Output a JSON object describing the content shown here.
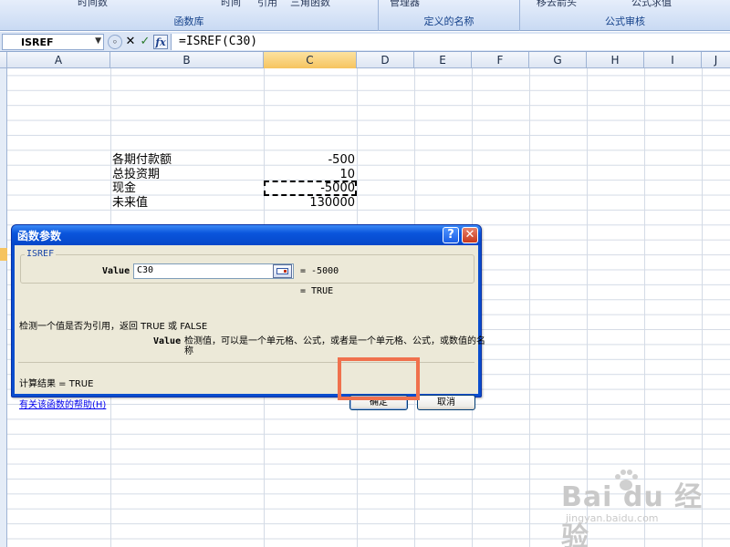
{
  "ribbon": {
    "groups": [
      {
        "title": "函数库",
        "items": [
          "时间数",
          "时间",
          "引用",
          "三角函数"
        ]
      },
      {
        "title": "定义的名称",
        "items": [
          "管理器"
        ]
      },
      {
        "title": "公式审核",
        "items": [
          "移去箭头",
          "公式求值"
        ]
      }
    ]
  },
  "formula_bar": {
    "name_box": "ISREF",
    "cancel_symbol": "✕",
    "enter_symbol": "✓",
    "fx_label": "fx",
    "formula": "=ISREF(C30)"
  },
  "columns": [
    "A",
    "B",
    "C",
    "D",
    "E",
    "F",
    "G",
    "H",
    "I",
    "J"
  ],
  "selected_column": "C",
  "cells": [
    {
      "label": "各期付款额",
      "value": "-500"
    },
    {
      "label": "总投资期",
      "value": "10"
    },
    {
      "label": "现金",
      "value": "-5000"
    },
    {
      "label": "未来值",
      "value": "130000"
    }
  ],
  "dialog": {
    "title": "函数参数",
    "help_symbol": "?",
    "close_symbol": "✕",
    "function_name": "ISREF",
    "arg_name": "Value",
    "arg_value": "C30",
    "arg_eval": "= -5000",
    "result_eval": "= TRUE",
    "description": "检测一个值是否为引用，返回 TRUE 或 FALSE",
    "param_name": "Value",
    "param_description": "检测值，可以是一个单元格、公式，或者是一个单元格、公式，或数值的名称",
    "result_label": "计算结果 = TRUE",
    "help_link": "有关该函数的帮助(H)",
    "ok_label": "确定",
    "cancel_label": "取消"
  },
  "watermark": {
    "brand": "Bai du 经验",
    "sub": "jingyan.baidu.com"
  },
  "colors": {
    "dialog_title_blue": "#0a55dc",
    "highlight_orange": "#f0714d",
    "selected_header": "#f6c45f"
  }
}
